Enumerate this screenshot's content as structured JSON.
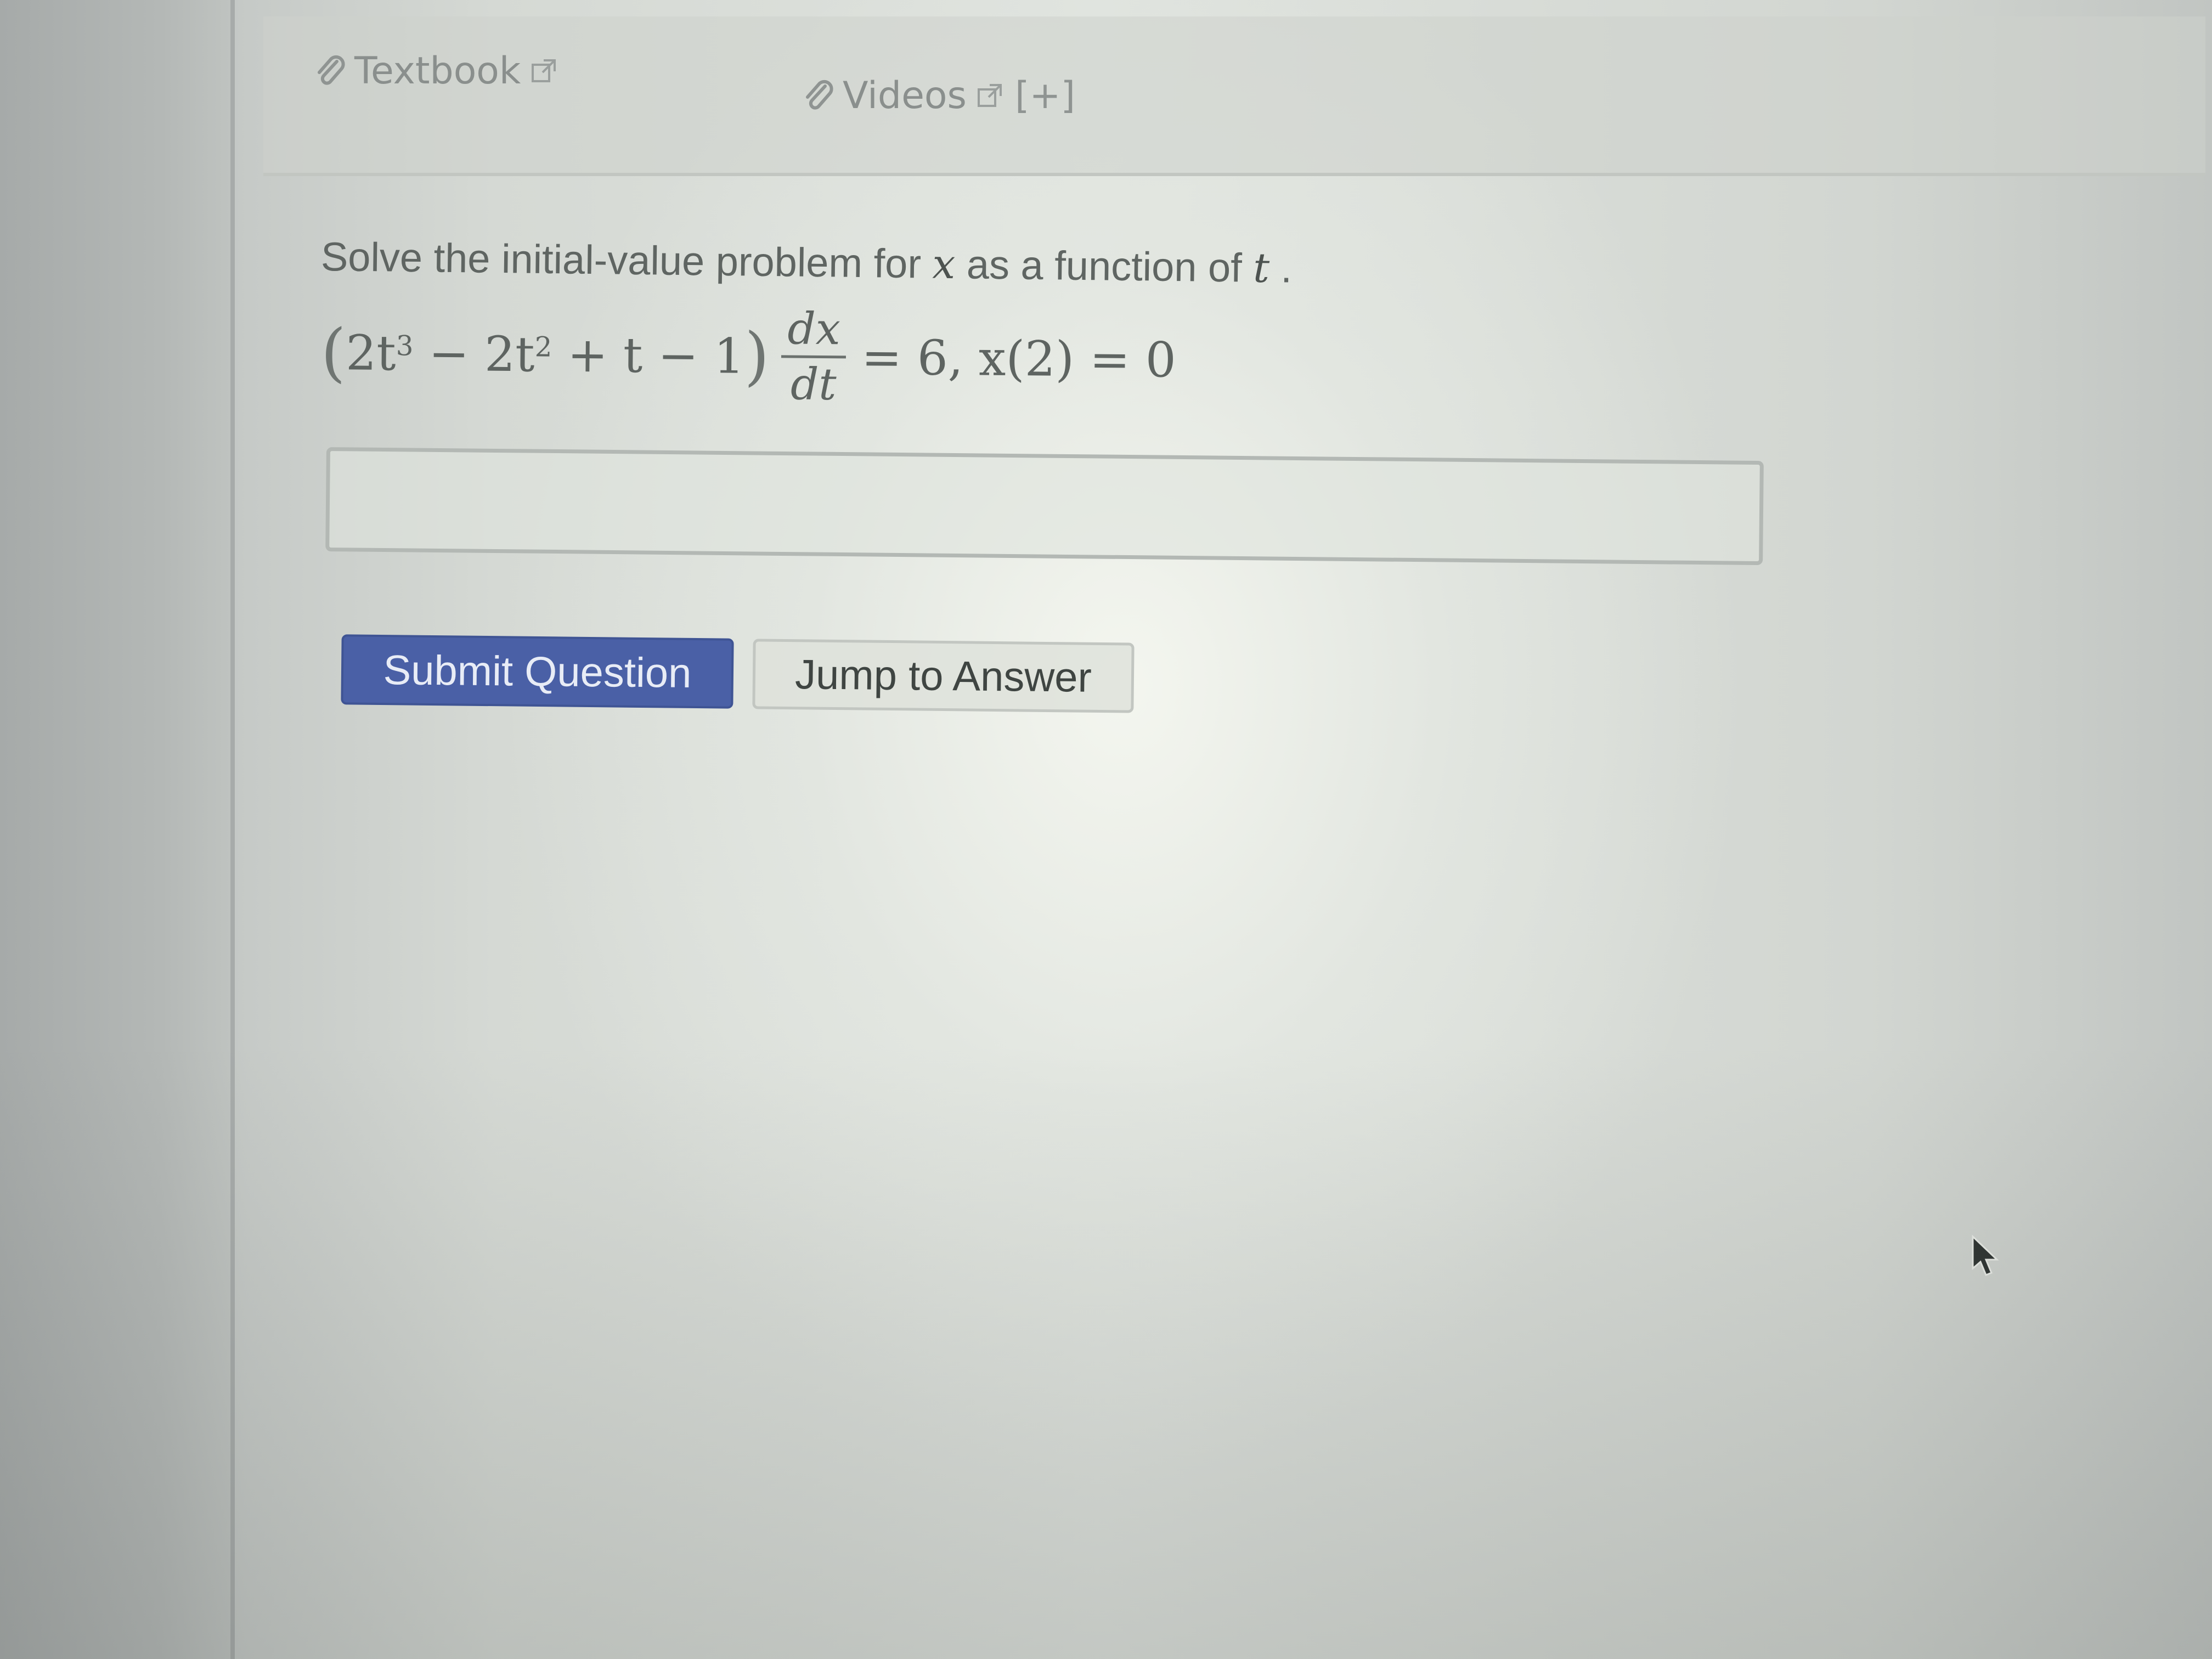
{
  "resources": {
    "textbook_label": "Textbook",
    "videos_label": "Videos",
    "expand_label": "[+]"
  },
  "question": {
    "prompt_before": "Solve the initial-value problem for",
    "prompt_var": "x",
    "prompt_middle": "as a function of",
    "prompt_var2": "t",
    "prompt_end": ".",
    "eq_open": "(",
    "eq_term1": "2t",
    "eq_exp1": "3",
    "eq_op1": " − ",
    "eq_term2": "2t",
    "eq_exp2": "2",
    "eq_rest_inner": " + t − 1",
    "eq_close": ")",
    "frac_num": "dx",
    "frac_den": "dt",
    "eq_rhs": "= 6, x(2) = 0"
  },
  "answer": {
    "value": ""
  },
  "buttons": {
    "submit_label": "Submit Question",
    "jump_label": "Jump to Answer"
  },
  "colors": {
    "submit_bg": "#4a60a6",
    "link_gray": "#8a8f8d"
  }
}
